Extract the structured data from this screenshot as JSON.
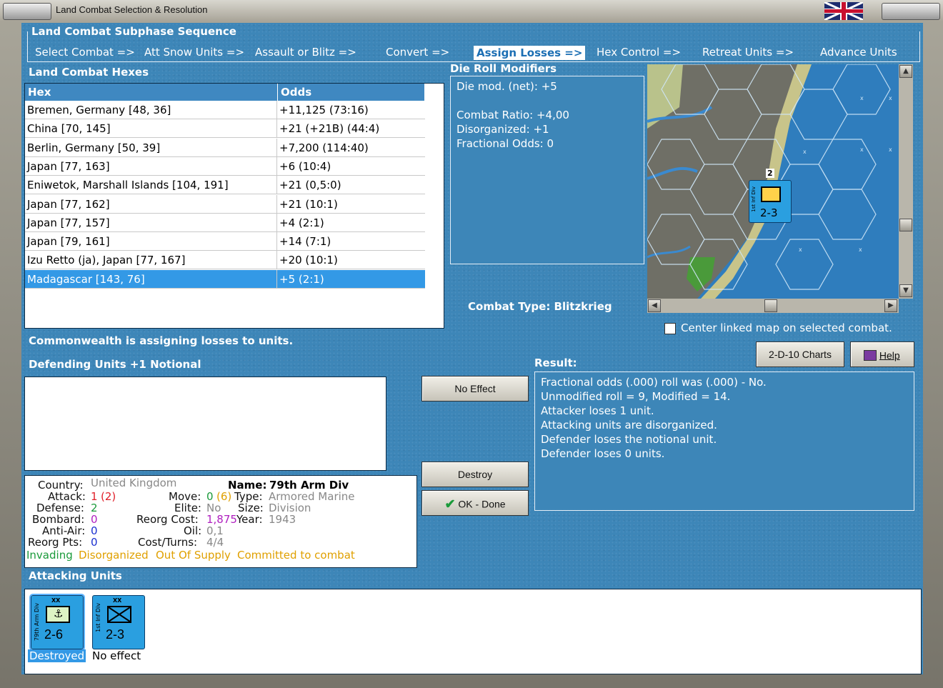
{
  "window": {
    "title": "Land Combat Selection & Resolution"
  },
  "sequence": {
    "title": "Land Combat Subphase Sequence",
    "steps": [
      "Select Combat =>",
      "Att Snow Units =>",
      "Assault or Blitz =>",
      "Convert =>",
      "Assign Losses =>",
      "Hex Control =>",
      "Retreat Units =>",
      "Advance Units"
    ],
    "active_index": 4
  },
  "hexes": {
    "title": "Land Combat Hexes",
    "columns": [
      "Hex",
      "Odds"
    ],
    "rows": [
      [
        "Bremen, Germany [48, 36]",
        "+11,125 (73:16)"
      ],
      [
        "China [70, 145]",
        "+21 (+21B) (44:4)"
      ],
      [
        "Berlin, Germany [50, 39]",
        "+7,200 (114:40)"
      ],
      [
        "Japan [77, 163]",
        "+6 (10:4)"
      ],
      [
        "Eniwetok, Marshall Islands [104, 191]",
        "+21 (0,5:0)"
      ],
      [
        "Japan [77, 162]",
        "+21 (10:1)"
      ],
      [
        "Japan [77, 157]",
        "+4 (2:1)"
      ],
      [
        "Japan [79, 161]",
        "+14 (7:1)"
      ],
      [
        "Izu Retto (ja), Japan [77, 167]",
        "+20 (10:1)"
      ],
      [
        "Madagascar [143, 76]",
        "+5 (2:1)"
      ]
    ],
    "selected_index": 9
  },
  "modifiers": {
    "title": "Die Roll Modifiers",
    "lines": [
      "Die mod. (net): +5",
      "",
      "Combat Ratio: +4,00",
      "Disorganized: +1",
      "Fractional Odds: 0"
    ]
  },
  "combat_type": "Combat Type:  Blitzkrieg",
  "map": {
    "unit_strength": "2-3",
    "unit_label": "1st Inf Div",
    "stack_count": "2"
  },
  "center_map": {
    "label": "Center linked map on selected combat.",
    "checked": false
  },
  "status_message": "Commonwealth is assigning losses to units.",
  "defending": {
    "title": "Defending Units +1 Notional"
  },
  "buttons": {
    "no_effect": "No Effect",
    "destroy": "Destroy",
    "ok_done": "OK - Done",
    "charts": "2-D-10 Charts",
    "help": "Help"
  },
  "result": {
    "title": "Result:",
    "lines": [
      "Fractional odds (.000) roll was (.000)  - No.",
      "Unmodified roll = 9, Modified = 14.",
      "Attacker loses 1 unit.",
      "Attacking units are disorganized.",
      "Defender loses the notional unit.",
      "Defender loses 0 units."
    ]
  },
  "unit_info": {
    "country_k": "Country:",
    "country_v": "United Kingdom",
    "name_k": "Name:",
    "name_v": "79th Arm Div",
    "attack_k": "Attack:",
    "attack_v": "1",
    "attack_v2": "(2)",
    "move_k": "Move:",
    "move_v": "0",
    "move_v2": "(6)",
    "type_k": "Type:",
    "type_v": "Armored Marine",
    "defense_k": "Defense:",
    "defense_v": "2",
    "elite_k": "Elite:",
    "elite_v": "No",
    "size_k": "Size:",
    "size_v": "Division",
    "bombard_k": "Bombard:",
    "bombard_v": "0",
    "reorg_k": "Reorg Cost:",
    "reorg_v": "1,875",
    "year_k": "Year:",
    "year_v": "1943",
    "antiair_k": "Anti-Air:",
    "antiair_v": "0",
    "oil_k": "Oil:",
    "oil_v": "0,1",
    "reorgpts_k": "Reorg Pts:",
    "reorgpts_v": "0",
    "cost_k": "Cost/Turns:",
    "cost_v": "4/4",
    "flags": [
      "Invading",
      "Disorganized",
      "Out Of Supply",
      "Committed to combat"
    ]
  },
  "attacking": {
    "title": "Attacking Units",
    "units": [
      {
        "label": "79th Arm Div",
        "strength": "2-6",
        "status": "Destroyed"
      },
      {
        "label": "1st Inf Div",
        "strength": "2-3",
        "status": "No effect"
      }
    ]
  },
  "colors": {
    "panel": "#3d86b8",
    "selected": "#3399e6",
    "unit": "#2a9fe0",
    "red": "#e0202a",
    "green": "#1a9a3a",
    "orange": "#e0a000",
    "purple": "#b020c0",
    "blue": "#1a30d0",
    "grey": "#888888"
  }
}
